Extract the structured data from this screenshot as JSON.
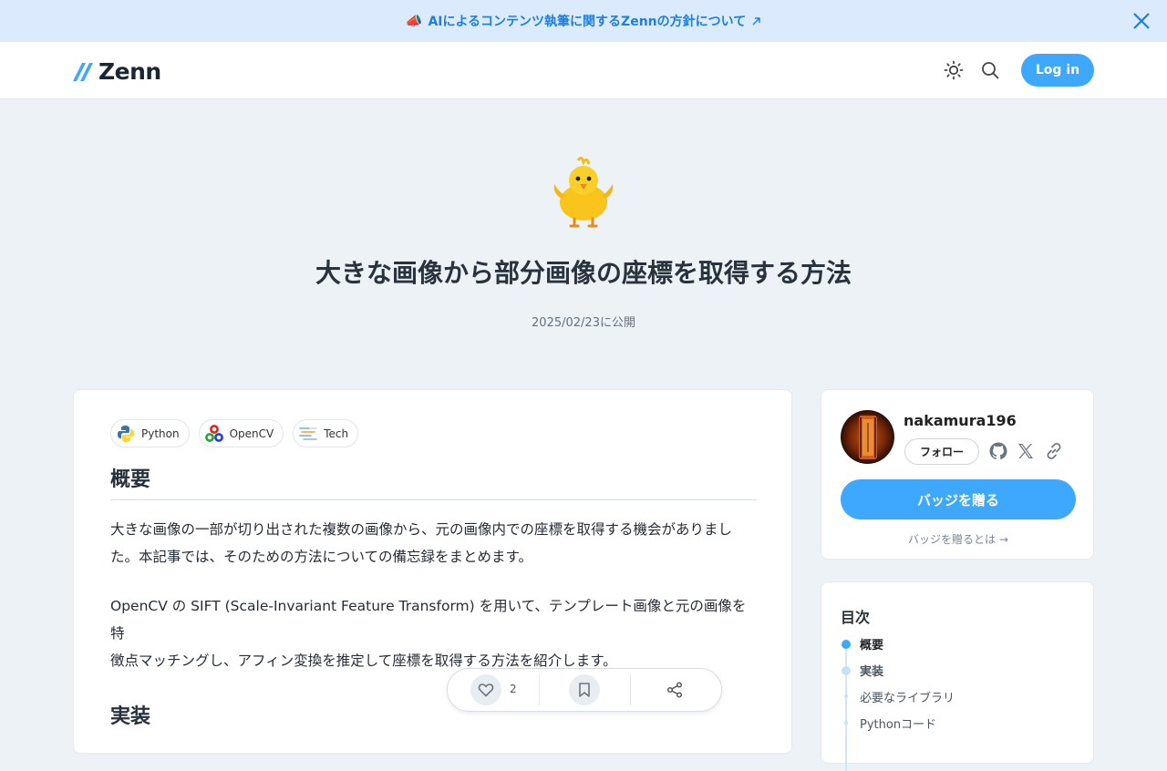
{
  "banner": {
    "megaphone_icon": "megaphone-icon",
    "text": "AIによるコンテンツ執筆に関するZennの方針について",
    "accent": "#1d7fe0"
  },
  "header": {
    "logo_text": "Zenn",
    "login_label": "Log in",
    "brand_color": "#3ea8ff"
  },
  "article": {
    "title": "大きな画像から部分画像の座標を取得する方法",
    "published": "2025/02/23に公開",
    "topics": [
      {
        "label": "Python",
        "icon": "python-icon"
      },
      {
        "label": "OpenCV",
        "icon": "opencv-icon"
      },
      {
        "label": "Tech",
        "icon": "tech-icon"
      }
    ],
    "section1_heading": "概要",
    "para1_line1": "大きな画像の一部が切り出された複数の画像から、元の画像内での座標を取得する機会がありまし",
    "para1_line2": "た。本記事では、そのための方法についての備忘録をまとめます。",
    "para2_line1": "OpenCV の SIFT (Scale-Invariant Feature Transform) を用いて、テンプレート画像と元の画像を特",
    "para2_line2": "徴点マッチングし、アフィン変換を推定して座標を取得する方法を紹介します。",
    "section2_heading": "実装"
  },
  "reactions": {
    "likes": "2"
  },
  "author": {
    "name": "nakamura196",
    "follow_label": "フォロー",
    "badge_label": "バッジを贈る",
    "badge_help": "バッジを贈るとは"
  },
  "toc": {
    "title": "目次",
    "items": [
      "概要",
      "実装",
      "必要なライブラリ",
      "Pythonコード"
    ]
  }
}
